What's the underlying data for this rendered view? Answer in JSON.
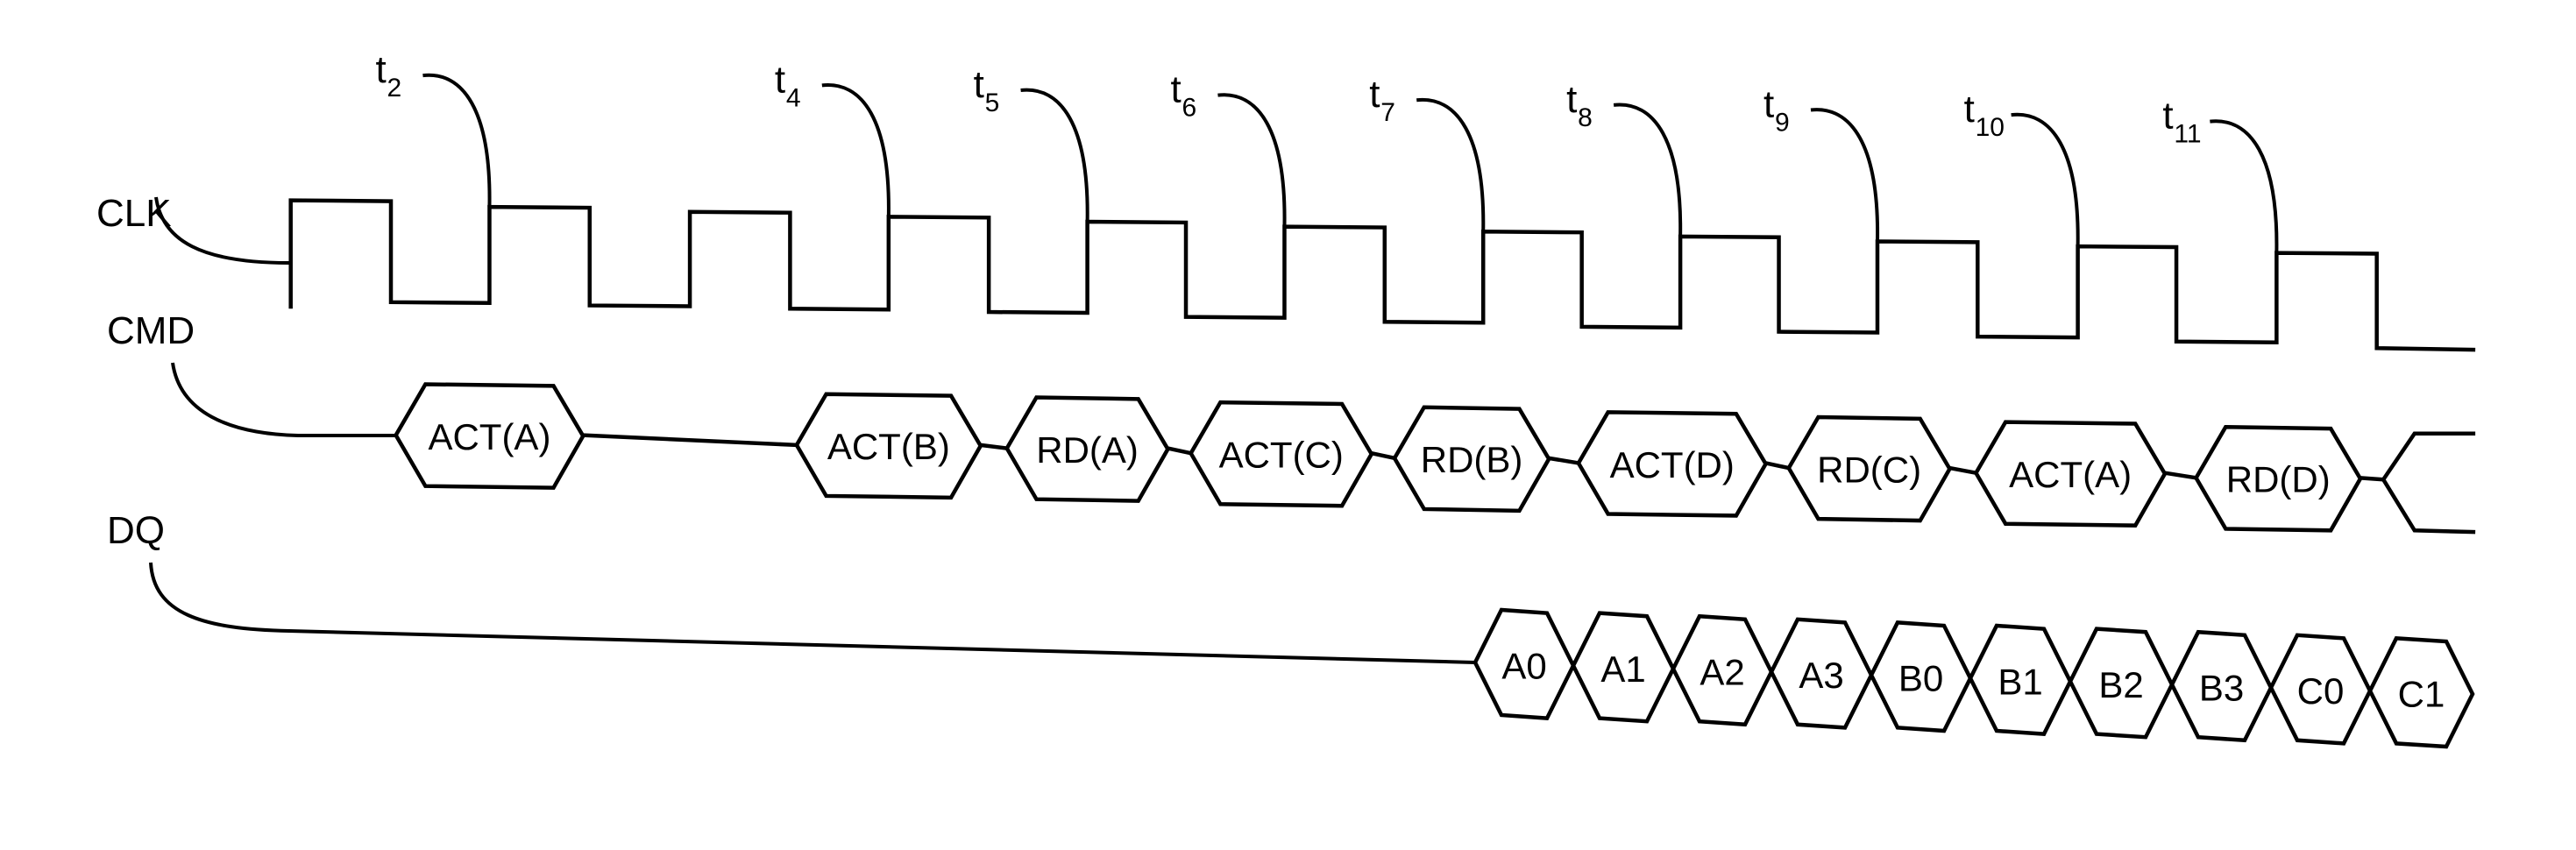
{
  "diagram": {
    "type": "timing-diagram",
    "signals": {
      "clk": {
        "label": "CLK"
      },
      "cmd": {
        "label": "CMD"
      },
      "dq": {
        "label": "DQ"
      }
    },
    "clock_markers": [
      {
        "t": "t",
        "sub": "2",
        "edge_index": 1
      },
      {
        "t": "t",
        "sub": "4",
        "edge_index": 3
      },
      {
        "t": "t",
        "sub": "5",
        "edge_index": 4
      },
      {
        "t": "t",
        "sub": "6",
        "edge_index": 5
      },
      {
        "t": "t",
        "sub": "7",
        "edge_index": 6
      },
      {
        "t": "t",
        "sub": "8",
        "edge_index": 7
      },
      {
        "t": "t",
        "sub": "9",
        "edge_index": 8
      },
      {
        "t": "t",
        "sub": "10",
        "edge_index": 9
      },
      {
        "t": "t",
        "sub": "11",
        "edge_index": 10
      }
    ],
    "clock_cycles": 11,
    "cmd_sequence": [
      {
        "label": "ACT(A)",
        "cycle": 1
      },
      {
        "label": "ACT(B)",
        "cycle": 3
      },
      {
        "label": "RD(A)",
        "cycle": 4
      },
      {
        "label": "ACT(C)",
        "cycle": 5
      },
      {
        "label": "RD(B)",
        "cycle": 6
      },
      {
        "label": "ACT(D)",
        "cycle": 7
      },
      {
        "label": "RD(C)",
        "cycle": 8
      },
      {
        "label": "ACT(A)",
        "cycle": 9
      },
      {
        "label": "RD(D)",
        "cycle": 10
      }
    ],
    "dq_sequence": [
      "A0",
      "A1",
      "A2",
      "A3",
      "B0",
      "B1",
      "B2",
      "B3",
      "C0",
      "C1"
    ]
  }
}
